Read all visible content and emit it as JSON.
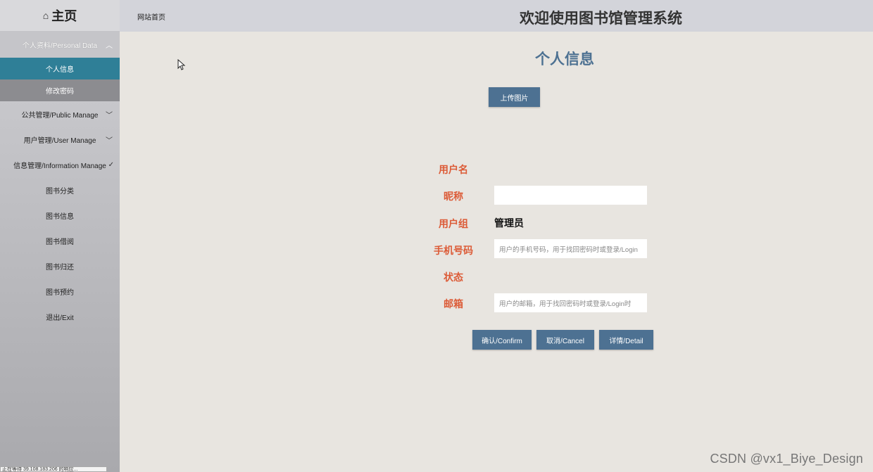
{
  "sidebar": {
    "home": "主页",
    "home_icon": "home-icon",
    "groups": [
      {
        "label": "个人资料/Personal Data",
        "open": true,
        "chevron": "chevron-up-icon"
      },
      {
        "label": "公共管理/Public Manage",
        "open": false,
        "chevron": "chevron-down-icon"
      },
      {
        "label": "用户管理/User Manage",
        "open": false,
        "chevron": "chevron-down-icon"
      },
      {
        "label": "信息管理/Information Manage",
        "open": true,
        "chevron": "chevron-down-icon"
      }
    ],
    "personal_sub": [
      "个人信息",
      "修改密码"
    ],
    "info_items": [
      "图书分类",
      "图书信息",
      "图书借阅",
      "图书归还",
      "图书预约",
      "退出/Exit"
    ],
    "status_text": "正在等待 39.108.183.206 的响应..."
  },
  "header": {
    "site_home": "网站首页",
    "app_title": "欢迎使用图书馆管理系统"
  },
  "main": {
    "page_title": "个人信息",
    "upload_label": "上传图片",
    "fields": {
      "username_label": "用户名",
      "nickname_label": "昵称",
      "nickname_value": "",
      "group_label": "用户组",
      "group_value": "管理员",
      "phone_label": "手机号码",
      "phone_placeholder": "用户的手机号码，用于找回密码时或登录/Login",
      "status_label": "状态",
      "email_label": "邮箱",
      "email_placeholder": "用户的邮箱，用于找回密码时或登录/Login时"
    },
    "buttons": {
      "confirm": "确认/Confirm",
      "cancel": "取消/Cancel",
      "detail": "详情/Detail"
    }
  },
  "watermark": "CSDN @vx1_Biye_Design",
  "colors": {
    "accent": "#4d7192",
    "label": "#dc5b37",
    "active_menu": "#2f7f97",
    "background": "#e8e5e0"
  }
}
